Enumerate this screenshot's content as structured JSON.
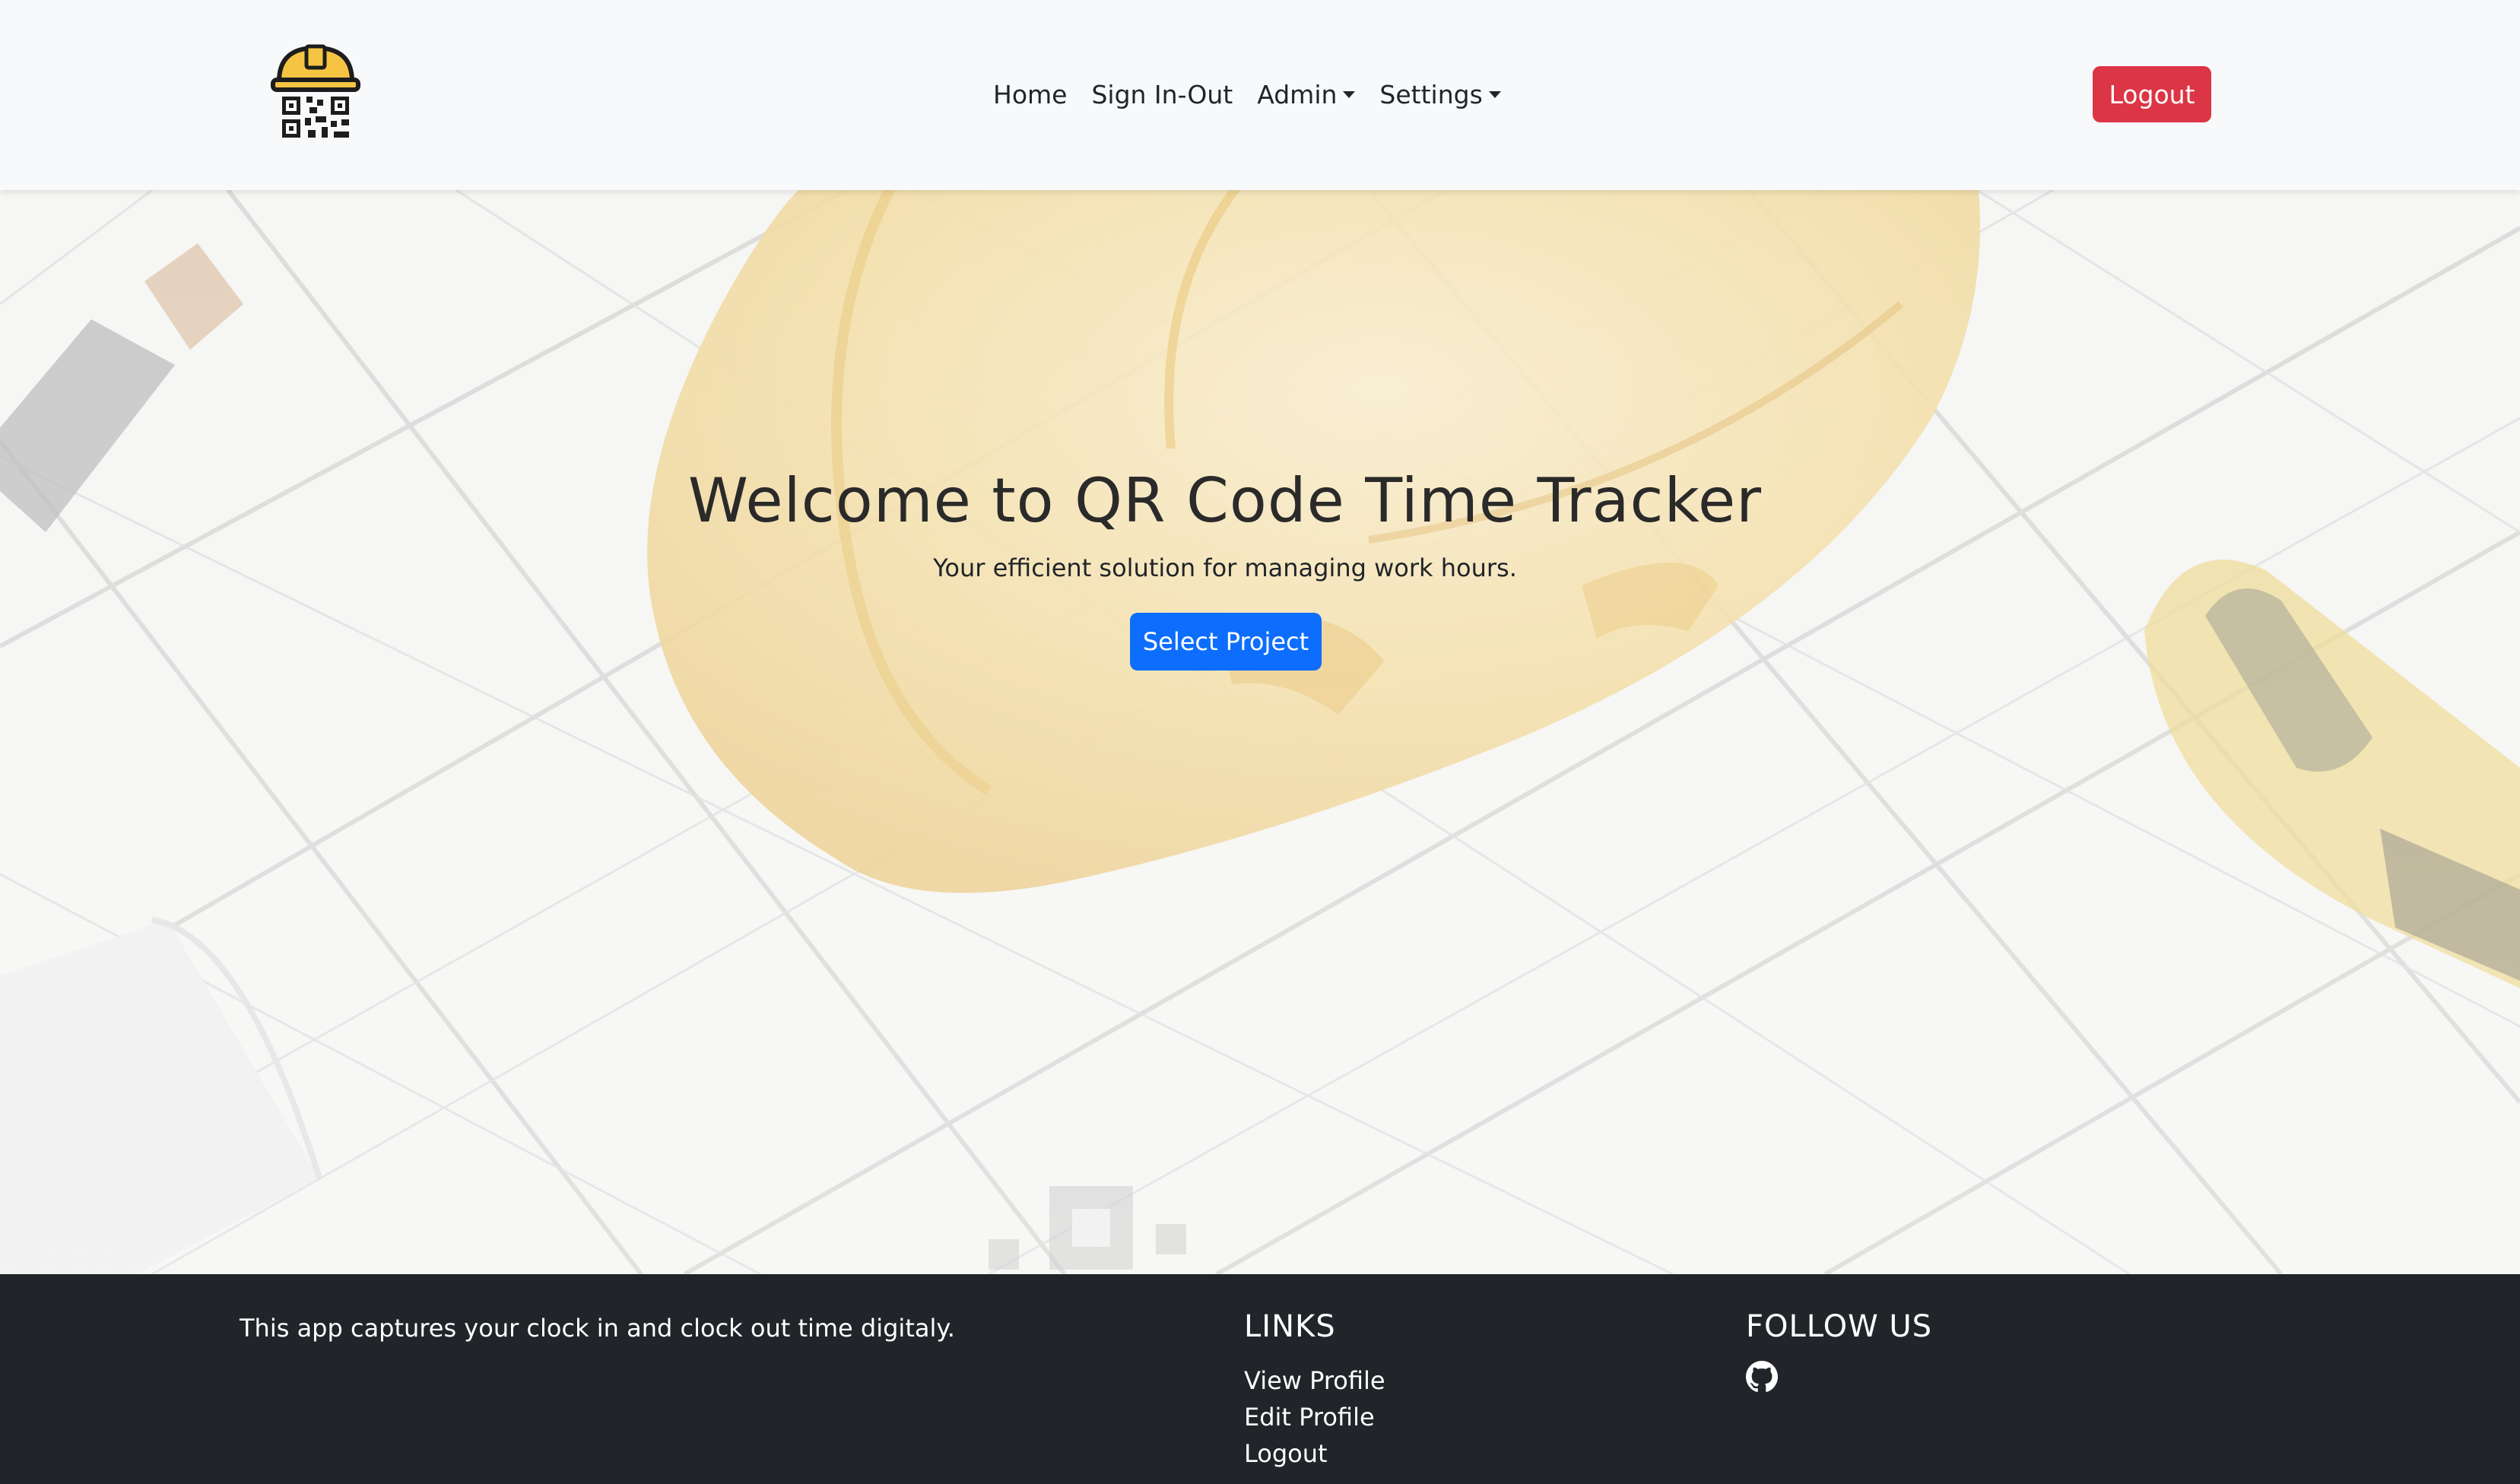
{
  "navbar": {
    "logo_icon": "hardhat-qr-logo-icon",
    "links": [
      {
        "label": "Home"
      },
      {
        "label": "Sign In-Out"
      },
      {
        "label": "Admin"
      },
      {
        "label": "Settings"
      }
    ],
    "logout_label": "Logout",
    "logout_color": "#dc3545"
  },
  "hero": {
    "title": "Welcome to QR Code Time Tracker",
    "subtitle": "Your efficient solution for managing work hours.",
    "button_label": "Select Project",
    "button_color": "#0d6efd"
  },
  "footer": {
    "about": "This app captures your clock in and clock out time digitaly.",
    "links_heading": "LINKS",
    "links": [
      {
        "label": "View Profile"
      },
      {
        "label": "Edit Profile"
      },
      {
        "label": "Logout"
      }
    ],
    "follow_heading": "FOLLOW US",
    "social_icon": "github-icon",
    "background": "#212529"
  }
}
